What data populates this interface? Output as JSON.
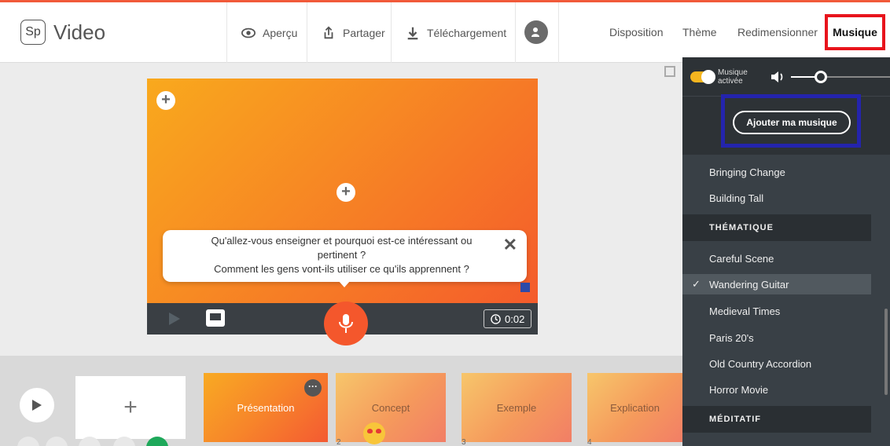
{
  "app": {
    "logo": "Sp",
    "name": "Video"
  },
  "toolbar": {
    "preview": "Aperçu",
    "share": "Partager",
    "download": "Téléchargement"
  },
  "tabs": {
    "layout": "Disposition",
    "theme": "Thème",
    "resize": "Redimensionner",
    "music": "Musique"
  },
  "slide": {
    "prompt_line1": "Qu'allez-vous enseigner et pourquoi est-ce intéressant ou",
    "prompt_line2": "pertinent ?",
    "prompt_line3": "Comment les gens vont-ils utiliser ce qu'ils apprennent ?",
    "duration": "0:02"
  },
  "timeline": {
    "thumbs": [
      "Présentation",
      "Concept",
      "Exemple",
      "Explication"
    ],
    "numbers": [
      "2",
      "3",
      "4"
    ]
  },
  "music_panel": {
    "toggle_label_1": "Musique",
    "toggle_label_2": "activée",
    "volume_level": 0.3,
    "add_button": "Ajouter ma musique",
    "tracks_top": [
      "Bringing Change",
      "Building Tall"
    ],
    "section_thematique": "THÉMATIQUE",
    "tracks_thematique": [
      "Careful Scene",
      "Wandering Guitar",
      "Medieval Times",
      "Paris 20's",
      "Old Country Accordion",
      "Horror Movie"
    ],
    "selected_track": "Wandering Guitar",
    "section_meditatif": "MÉDITATIF"
  },
  "colors": {
    "accent": "#f4572c",
    "highlight_red": "#e8141c",
    "highlight_blue": "#2424ad",
    "toggle_on": "#f5b51f"
  }
}
